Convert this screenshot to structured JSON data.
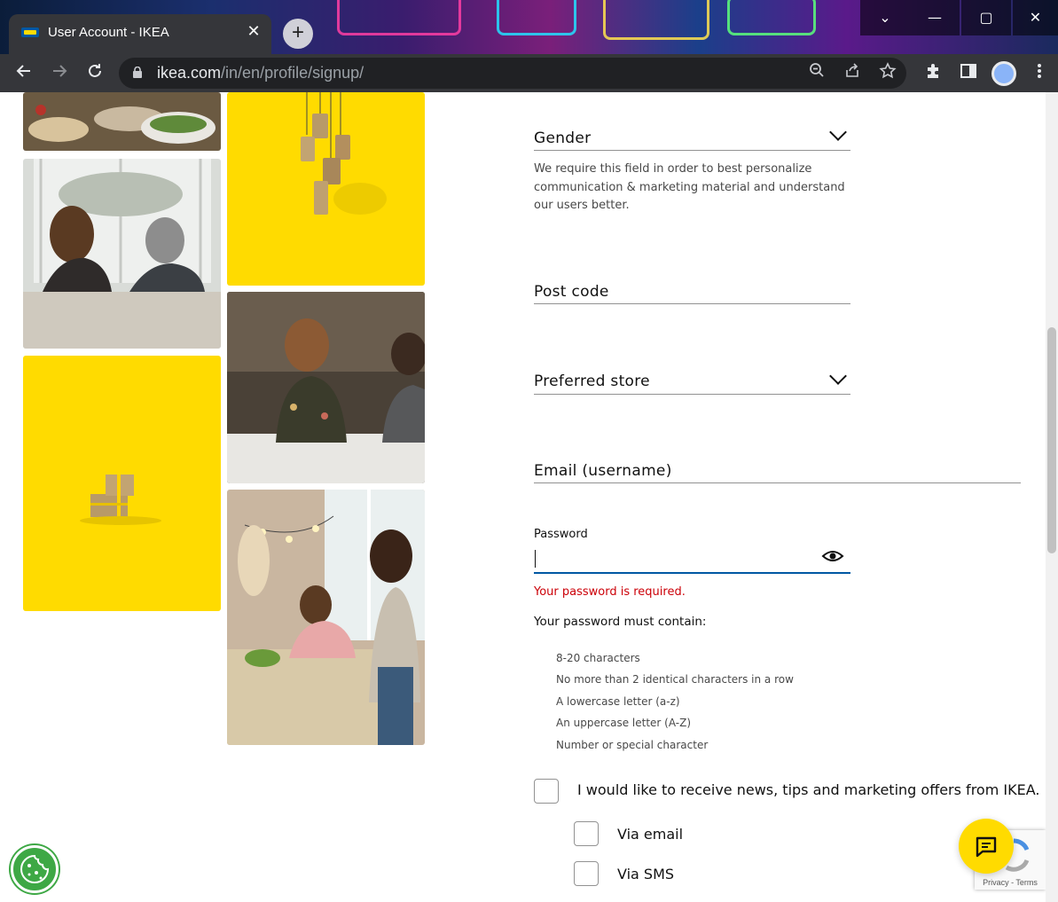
{
  "browser": {
    "tab_title": "User Account - IKEA",
    "tab_close": "✕",
    "new_tab": "+",
    "url_host": "ikea.com",
    "url_path": "/in/en/profile/signup/",
    "window_controls": [
      "⌄",
      "—",
      "▢",
      "✕"
    ]
  },
  "form": {
    "gender_label": "Gender",
    "gender_help": "We require this field in order to best personalize communication & marketing material and understand our users better.",
    "postcode_label": "Post code",
    "store_label": "Preferred store",
    "email_label": "Email (username)",
    "password_label": "Password",
    "password_value": "",
    "password_error": "Your password is required.",
    "requirements_title": "Your password must contain:",
    "requirements": [
      "8-20 characters",
      "No more than 2 identical characters in a row",
      "A lowercase letter (a-z)",
      "An uppercase letter (A-Z)",
      "Number or special character"
    ],
    "marketing_label": "I would like to receive news, tips and marketing offers from IKEA.",
    "via_email_label": "Via email",
    "via_sms_label": "Via SMS"
  },
  "recaptcha": {
    "text": "Privacy - Terms"
  },
  "colors": {
    "ikea_yellow": "#ffdb00",
    "ikea_blue": "#0058a3",
    "error_red": "#cc0008"
  }
}
